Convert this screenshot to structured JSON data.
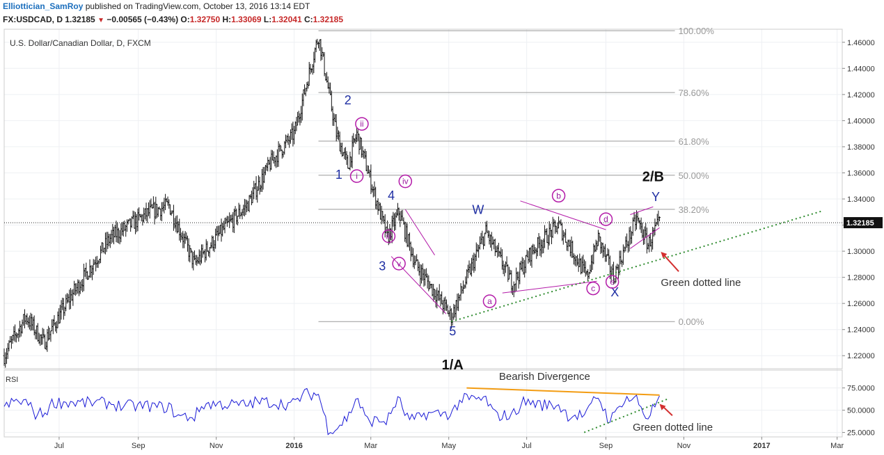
{
  "header": {
    "author": "Elliottician_SamRoy",
    "published": "published on TradingView.com, October 13, 2016 13:14 EDT",
    "symbol": "FX:USDCAD, D",
    "last": "1.32185",
    "change": "−0.00565 (−0.43%)",
    "open_label": "O:",
    "open": "1.32750",
    "high_label": "H:",
    "high": "1.33069",
    "low_label": "L:",
    "low": "1.32041",
    "close_label": "C:",
    "close": "1.32185"
  },
  "colors": {
    "candle": "#111111",
    "rsi": "#1a1ad6",
    "wave_blue": "#1f2fa3",
    "wave_magenta": "#b31aa8",
    "fib": "#999999",
    "green_dotted": "#2e8b2e",
    "orange": "#f39c12",
    "arrow_red": "#d32f2f"
  },
  "chart_data": [
    {
      "type": "candlestick",
      "title": "U.S. Dollar/Canadian Dollar, D, FXCM",
      "ylim": [
        1.21,
        1.47
      ],
      "yticks": [
        "1.46000",
        "1.44000",
        "1.42000",
        "1.40000",
        "1.38000",
        "1.36000",
        "1.34000",
        "1.32000",
        "1.30000",
        "1.28000",
        "1.26000",
        "1.24000",
        "1.22000"
      ],
      "last_price": "1.32185",
      "xticks": [
        "Jul",
        "Sep",
        "Nov",
        "2016",
        "Mar",
        "May",
        "Jul",
        "Sep",
        "Nov",
        "2017",
        "Mar"
      ],
      "close_path": [
        {
          "date": "2015-05-19",
          "v": 1.22
        },
        {
          "date": "2015-06-05",
          "v": 1.25
        },
        {
          "date": "2015-06-19",
          "v": 1.23
        },
        {
          "date": "2015-07-10",
          "v": 1.265
        },
        {
          "date": "2015-08-10",
          "v": 1.31
        },
        {
          "date": "2015-09-10",
          "v": 1.33
        },
        {
          "date": "2015-09-25",
          "v": 1.335
        },
        {
          "date": "2015-10-15",
          "v": 1.29
        },
        {
          "date": "2015-11-05",
          "v": 1.315
        },
        {
          "date": "2015-11-25",
          "v": 1.335
        },
        {
          "date": "2015-12-15",
          "v": 1.37
        },
        {
          "date": "2016-01-01",
          "v": 1.39
        },
        {
          "date": "2016-01-20",
          "v": 1.465
        },
        {
          "date": "2016-02-03",
          "v": 1.39
        },
        {
          "date": "2016-02-12",
          "v": 1.365
        },
        {
          "date": "2016-02-19",
          "v": 1.39
        },
        {
          "date": "2016-03-02",
          "v": 1.35
        },
        {
          "date": "2016-03-14",
          "v": 1.31
        },
        {
          "date": "2016-03-23",
          "v": 1.33
        },
        {
          "date": "2016-04-05",
          "v": 1.29
        },
        {
          "date": "2016-05-03",
          "v": 1.25
        },
        {
          "date": "2016-05-30",
          "v": 1.315
        },
        {
          "date": "2016-06-20",
          "v": 1.275
        },
        {
          "date": "2016-07-05",
          "v": 1.3
        },
        {
          "date": "2016-07-26",
          "v": 1.32
        },
        {
          "date": "2016-08-17",
          "v": 1.28
        },
        {
          "date": "2016-08-26",
          "v": 1.31
        },
        {
          "date": "2016-09-07",
          "v": 1.28
        },
        {
          "date": "2016-09-25",
          "v": 1.325
        },
        {
          "date": "2016-10-04",
          "v": 1.305
        },
        {
          "date": "2016-10-13",
          "v": 1.322
        }
      ],
      "fib_levels": [
        {
          "label": "100.00%",
          "price": 1.4689
        },
        {
          "label": "78.60%",
          "price": 1.4215
        },
        {
          "label": "61.80%",
          "price": 1.3843
        },
        {
          "label": "50.00%",
          "price": 1.3582
        },
        {
          "label": "38.20%",
          "price": 1.3321
        },
        {
          "label": "0.00%",
          "price": 1.2461
        }
      ],
      "wave_labels": {
        "w1": "1",
        "w2": "2",
        "w3": "3",
        "w4": "4",
        "w5": "5",
        "w1a": "1/A",
        "w2b": "2/B",
        "W": "W",
        "X": "X",
        "Y": "Y",
        "i": "i",
        "ii": "ii",
        "iii": "iii",
        "iv": "iv",
        "v": "v",
        "a": "a",
        "b": "b",
        "c": "c",
        "d": "d",
        "e": "e"
      },
      "annotations": {
        "green_line": "Green dotted line"
      }
    },
    {
      "type": "line",
      "title": "RSI",
      "ylim": [
        20,
        95
      ],
      "yticks": [
        "75.0000",
        "50.0000",
        "25.0000"
      ],
      "annotations": {
        "divergence": "Bearish Divergence",
        "green_line": "Green dotted line"
      }
    }
  ]
}
